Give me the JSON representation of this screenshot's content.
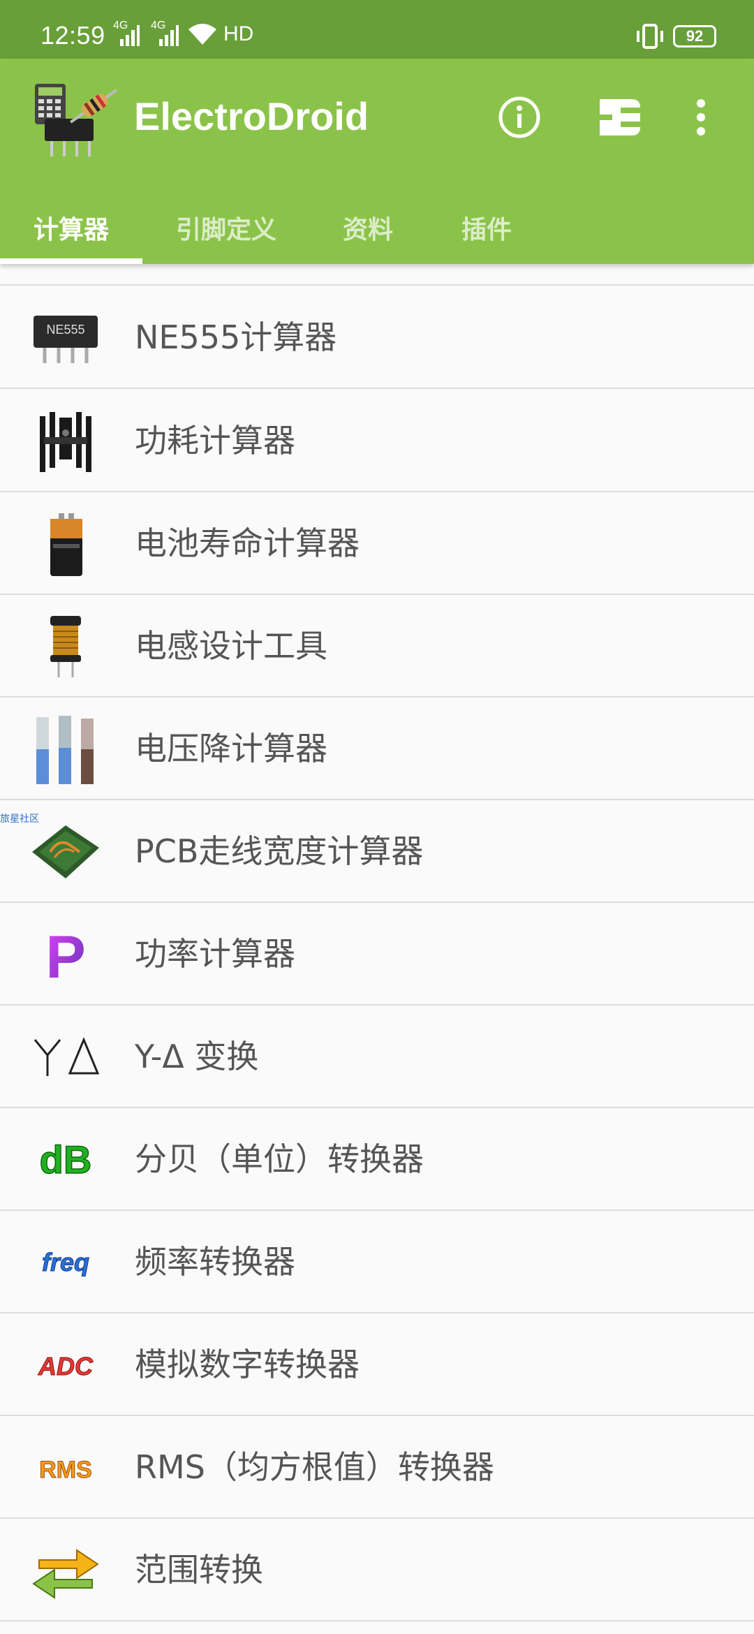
{
  "status_bar": {
    "time": "12:59",
    "net1": "4G",
    "net2": "4G",
    "hd": "HD",
    "battery": "92"
  },
  "app_bar": {
    "title": "ElectroDroid",
    "tabs": [
      "计算器",
      "引脚定义",
      "资料",
      "插件"
    ],
    "active_tab": 0
  },
  "list": {
    "partial_top_item": "…",
    "items": [
      {
        "label": "NE555计算器",
        "icon": "ne555-chip-icon"
      },
      {
        "label": "功耗计算器",
        "icon": "heatsink-icon"
      },
      {
        "label": "电池寿命计算器",
        "icon": "battery-icon"
      },
      {
        "label": "电感设计工具",
        "icon": "inductor-icon"
      },
      {
        "label": "电压降计算器",
        "icon": "wire-cables-icon"
      },
      {
        "label": "PCB走线宽度计算器",
        "icon": "pcb-icon"
      },
      {
        "label": "功率计算器",
        "icon": "power-p-icon"
      },
      {
        "label": "Y-Δ 变换",
        "icon": "y-delta-icon"
      },
      {
        "label": "分贝（单位）转换器",
        "icon": "db-icon"
      },
      {
        "label": "频率转换器",
        "icon": "freq-icon"
      },
      {
        "label": "模拟数字转换器",
        "icon": "adc-icon"
      },
      {
        "label": "RMS（均方根值）转换器",
        "icon": "rms-icon"
      },
      {
        "label": "范围转换",
        "icon": "range-arrows-icon"
      }
    ],
    "icon_texts": {
      "ne555": "NE555",
      "db": "dB",
      "freq": "freq",
      "adc": "ADC",
      "rms": "RMS",
      "p": "P"
    },
    "watermark": "旅星社区"
  },
  "colors": {
    "status_bar": "#689f38",
    "app_bar": "#8bc34a",
    "text": "#555555",
    "divider": "#dcdcdc"
  }
}
